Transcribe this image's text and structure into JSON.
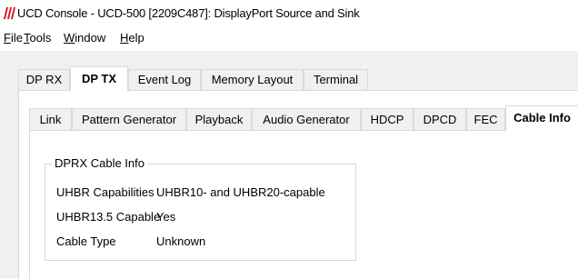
{
  "window": {
    "title": "UCD Console - UCD-500 [2209C487]: DisplayPort Source and Sink"
  },
  "menu": [
    {
      "first": "F",
      "rest": "ile"
    },
    {
      "first": "T",
      "rest": "ools"
    },
    {
      "first": "W",
      "rest": "indow"
    },
    {
      "first": "H",
      "rest": "elp"
    }
  ],
  "main_tabs": [
    "DP RX",
    "DP TX",
    "Event Log",
    "Memory Layout",
    "Terminal"
  ],
  "main_tab_active": "DP TX",
  "sub_tabs": [
    "Link",
    "Pattern Generator",
    "Playback",
    "Audio Generator",
    "HDCP",
    "DPCD",
    "FEC",
    "Cable Info"
  ],
  "sub_tab_active": "Cable Info",
  "cable_info": {
    "group_title": "DPRX Cable Info",
    "rows": [
      {
        "label": "UHBR Capabilities",
        "value": "UHBR10- and UHBR20-capable"
      },
      {
        "label": "UHBR13.5 Capable",
        "value": "Yes"
      },
      {
        "label": "Cable Type",
        "value": "Unknown"
      }
    ]
  },
  "colors": {
    "icon_red": "#d4202c",
    "tab_inactive": "#f0f0f0",
    "border": "#d9d9d9"
  },
  "icons": {
    "app": "ucd-logo-icon"
  }
}
